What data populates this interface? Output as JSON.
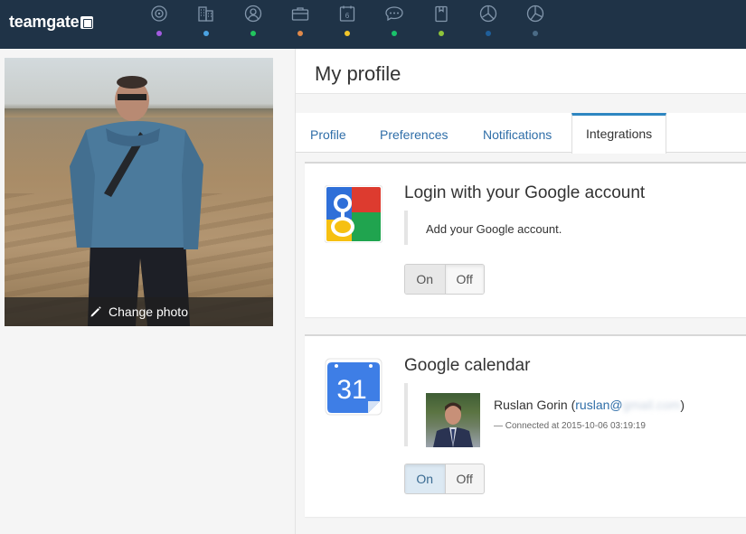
{
  "app": {
    "logo_text": "teamgate"
  },
  "nav": {
    "items": [
      {
        "icon": "target-icon",
        "dot_color": "#a25be0"
      },
      {
        "icon": "buildings-icon",
        "dot_color": "#4ba3e3"
      },
      {
        "icon": "person-icon",
        "dot_color": "#22c55e"
      },
      {
        "icon": "briefcase-icon",
        "dot_color": "#e0894a"
      },
      {
        "icon": "calendar-icon",
        "label": "6",
        "dot_color": "#f2c62a"
      },
      {
        "icon": "chat-icon",
        "dot_color": "#19c26b"
      },
      {
        "icon": "clipboard-icon",
        "dot_color": "#8ec43a"
      },
      {
        "icon": "pie-chart-icon",
        "dot_color": "#1f5f9a"
      },
      {
        "icon": "pie-chart-icon-2",
        "dot_color": "#4b6b86"
      }
    ]
  },
  "profile": {
    "change_photo_label": "Change photo"
  },
  "page": {
    "title": "My profile"
  },
  "tabs": [
    {
      "label": "Profile"
    },
    {
      "label": "Preferences"
    },
    {
      "label": "Notifications"
    },
    {
      "label": "Integrations",
      "active": true
    }
  ],
  "integrations": {
    "google": {
      "title": "Login with your Google account",
      "description": "Add your Google account.",
      "toggle": {
        "on_label": "On",
        "off_label": "Off",
        "state": "off"
      }
    },
    "calendar": {
      "title": "Google calendar",
      "logo_text": "31",
      "account": {
        "name": "Ruslan Gorin",
        "email_prefix": "ruslan@",
        "email_blurred": "gmail.com",
        "connected_text": "— Connected at 2015-10-06 03:19:19"
      },
      "toggle": {
        "on_label": "On",
        "off_label": "Off",
        "state": "on"
      }
    }
  }
}
